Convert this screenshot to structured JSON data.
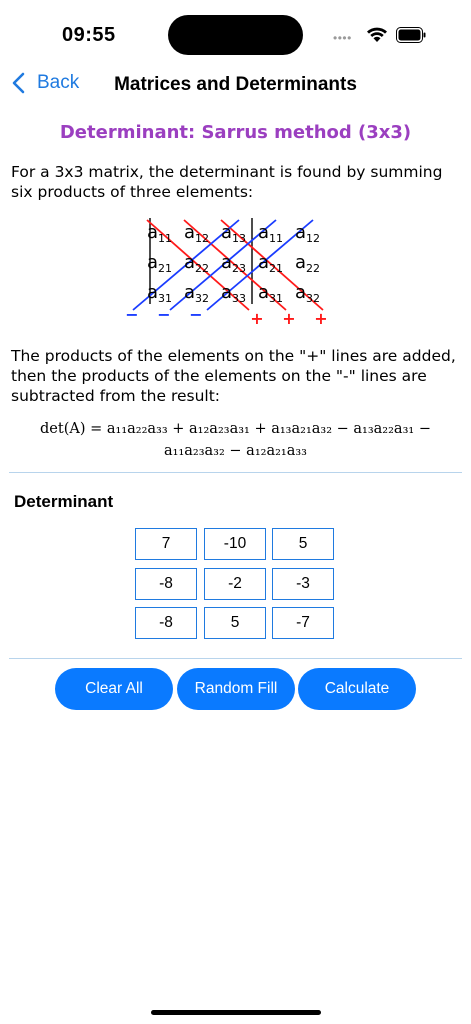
{
  "status": {
    "time": "09:55",
    "signal_dots": "••••"
  },
  "nav": {
    "back_label": "Back",
    "title": "Matrices and Determinants"
  },
  "section": {
    "title": "Determinant: Sarrus method (3x3)"
  },
  "intro_text": "For a 3x3 matrix, the determinant is found by summing six products of three elements:",
  "diagram": {
    "rows": [
      [
        "a11",
        "a12",
        "a13",
        "a11",
        "a12"
      ],
      [
        "a21",
        "a22",
        "a23",
        "a21",
        "a22"
      ],
      [
        "a31",
        "a32",
        "a33",
        "a31",
        "a32"
      ]
    ],
    "minus_signs": [
      "−",
      "−",
      "−"
    ],
    "plus_signs": [
      "+",
      "+",
      "+"
    ],
    "colors": {
      "plus": "#ff1a1a",
      "minus": "#1a3cff"
    }
  },
  "explain_text": "The products of the elements on the \"+\" lines are added, then the products of the elements on the \"-\" lines are subtracted from the result:",
  "formula": {
    "line1": "det(A) = a₁₁a₂₂a₃₃ + a₁₂a₂₃a₃₁ + a₁₃a₂₁a₃₂ − a₁₃a₂₂a₃₁ −",
    "line2": "a₁₁a₂₃a₃₂ − a₁₂a₂₁a₃₃"
  },
  "determinant": {
    "label": "Determinant",
    "matrix": [
      [
        "7",
        "-10",
        "5"
      ],
      [
        "-8",
        "-2",
        "-3"
      ],
      [
        "-8",
        "5",
        "-7"
      ]
    ]
  },
  "buttons": {
    "clear": "Clear All",
    "random": "Random Fill",
    "calculate": "Calculate"
  },
  "theme": {
    "accent": "#0a7aff",
    "title_color": "#9b3fc0",
    "divider": "#b8d4ec"
  }
}
